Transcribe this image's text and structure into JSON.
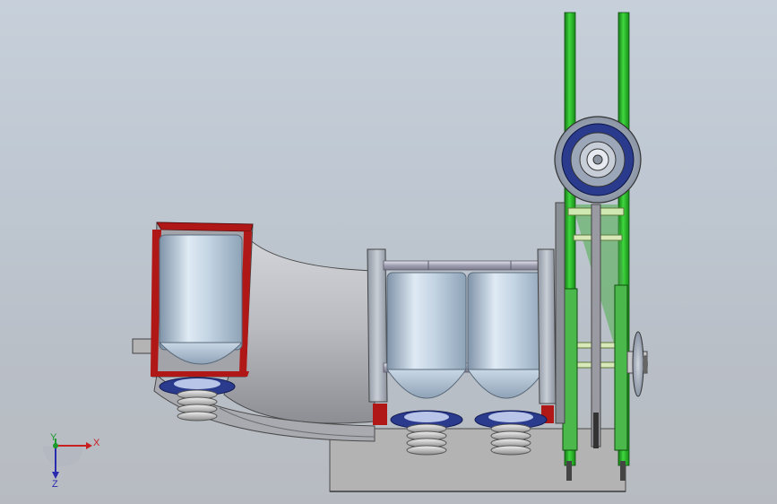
{
  "viewport": {
    "background_top": "#c7d0da",
    "background_bottom": "#b7bbc1"
  },
  "colors": {
    "frame_green": "#2fbf2f",
    "canister_blue": "#b8cfe0",
    "ring_navy": "#2a3a8c",
    "section_red": "#b01818",
    "base_gray": "#b2b2b2",
    "rod_gray": "#a8a8b8"
  },
  "triad": {
    "x_label": "X",
    "y_label": "Y",
    "z_label": "Z",
    "icon": "coordinate-triad-icon"
  }
}
